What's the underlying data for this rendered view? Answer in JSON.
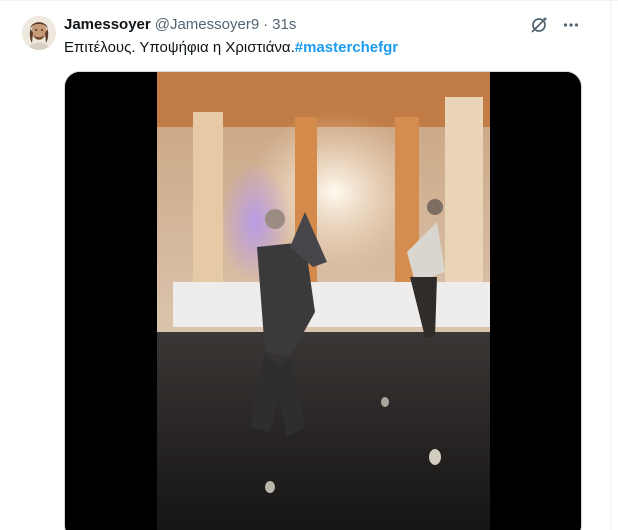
{
  "tweet": {
    "display_name": "Jamessoyer",
    "handle": "@Jamessoyer9",
    "separator": "·",
    "timestamp": "31s",
    "text": "Επιτέλους. Υποψήφια η Χριστιάνα.",
    "hashtag": "#masterchefgr"
  },
  "icons": {
    "grok": "grok-icon",
    "more": "more-icon"
  },
  "colors": {
    "primary_text": "#0f1419",
    "secondary_text": "#536471",
    "link": "#1d9bf0",
    "border": "#cfd9de"
  }
}
